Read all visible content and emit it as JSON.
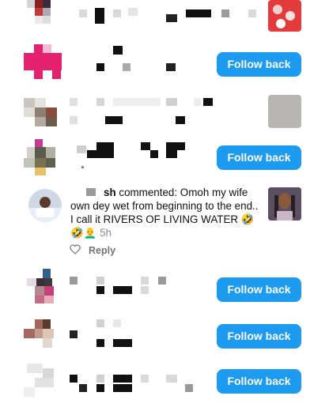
{
  "activity": {
    "follow_label": "Follow back",
    "comment": {
      "username": "sh",
      "verb": "commented:",
      "text": "Omoh my wife own dey wet from beginning to the end.. I call it RIVERS OF LIVING WATER",
      "emojis": "🤣🤣👨‍🦲",
      "time": "5h",
      "reply_label": "Reply"
    },
    "colors": {
      "follow_button": "#1d9bf0",
      "follow_text": "#ffffff",
      "timestamp": "#8e8e8e",
      "reply": "#737373"
    }
  }
}
